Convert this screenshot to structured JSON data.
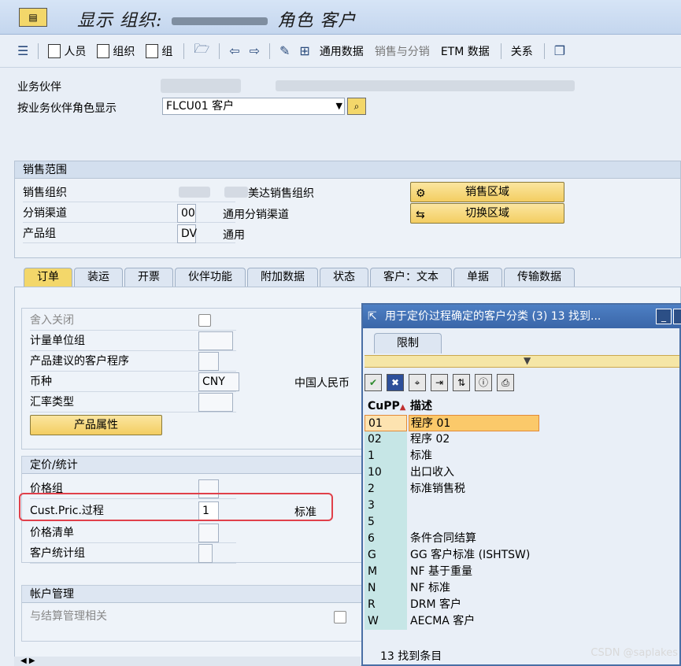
{
  "window": {
    "title_prefix": "显示 组织:",
    "title_suffix": "角色 客户"
  },
  "toolbar": {
    "persons": "人员",
    "organization": "组织",
    "group": "组",
    "general_data": "通用数据",
    "sales_distribution": "销售与分销",
    "etm_data": "ETM 数据",
    "relationships": "关系"
  },
  "header": {
    "bp_label": "业务伙伴",
    "role_label": "按业务伙伴角色显示",
    "role_value": "FLCU01 客户"
  },
  "sales_area": {
    "title": "销售范围",
    "sales_org_label": "销售组织",
    "sales_org_text": "美达销售组织",
    "dist_channel_label": "分销渠道",
    "dist_channel_value": "00",
    "dist_channel_text": "通用分销渠道",
    "division_label": "产品组",
    "division_value": "DV",
    "division_text": "通用",
    "btn_sales_areas": "销售区域",
    "btn_switch_area": "切换区域"
  },
  "tabs": [
    "订单",
    "装运",
    "开票",
    "伙伴功能",
    "附加数据",
    "状态",
    "客户：文本",
    "单据",
    "传输数据"
  ],
  "order_panel": {
    "rounding_off": "舍入关闭",
    "uom_group": "计量单位组",
    "product_proposal": "产品建议的客户程序",
    "currency_label": "币种",
    "currency_value": "CNY",
    "currency_text": "中国人民币",
    "exchange_rate_type": "汇率类型",
    "product_attributes_btn": "产品属性"
  },
  "pricing": {
    "title": "定价/统计",
    "price_group": "价格组",
    "cust_pric_proc": "Cust.Pric.过程",
    "cust_pric_value": "1",
    "cust_pric_text": "标准",
    "price_list": "价格清单",
    "cust_stat_group": "客户统计组"
  },
  "account_mgmt": {
    "title": "帐户管理",
    "settlement_relevant": "与结算管理相关"
  },
  "popup": {
    "title": "用于定价过程确定的客户分类 (3)   13 找到...",
    "tab": "限制",
    "col_code": "CuPP",
    "col_desc": "描述",
    "rows": [
      {
        "code": "01",
        "desc": "程序 01"
      },
      {
        "code": "02",
        "desc": "程序 02"
      },
      {
        "code": "1",
        "desc": "标准"
      },
      {
        "code": "10",
        "desc": "出口收入"
      },
      {
        "code": "2",
        "desc": "标准销售税"
      },
      {
        "code": "3",
        "desc": ""
      },
      {
        "code": "5",
        "desc": ""
      },
      {
        "code": "6",
        "desc": "条件合同结算"
      },
      {
        "code": "G",
        "desc": "GG 客户标准 (ISHTSW)"
      },
      {
        "code": "M",
        "desc": "NF 基于重量"
      },
      {
        "code": "N",
        "desc": "NF 标准"
      },
      {
        "code": "R",
        "desc": "DRM 客户"
      },
      {
        "code": "W",
        "desc": "AECMA 客户"
      }
    ],
    "footer": "13 找到条目"
  },
  "watermark": "CSDN @saplakes"
}
